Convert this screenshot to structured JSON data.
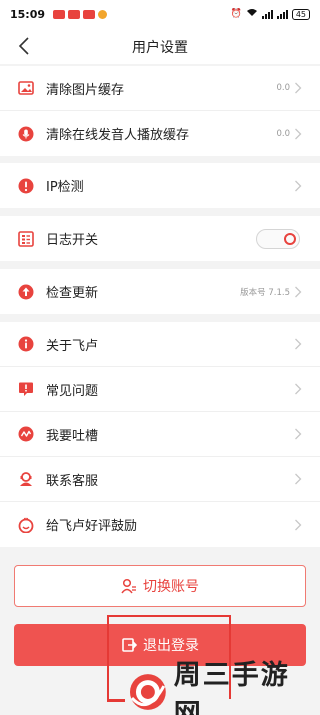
{
  "status_bar": {
    "time": "15:09",
    "battery": "45"
  },
  "nav": {
    "title": "用户设置"
  },
  "cache_group": [
    {
      "label": "清除图片缓存",
      "value": "0.0"
    },
    {
      "label": "清除在线发音人播放缓存",
      "value": "0.0"
    }
  ],
  "ip_group": {
    "label": "IP检测"
  },
  "log_group": {
    "label": "日志开关"
  },
  "update_group": {
    "label": "检查更新",
    "value": "版本号 7.1.5"
  },
  "about_group": [
    {
      "label": "关于飞卢"
    },
    {
      "label": "常见问题"
    },
    {
      "label": "我要吐槽"
    },
    {
      "label": "联系客服"
    },
    {
      "label": "给飞卢好评鼓励"
    }
  ],
  "buttons": {
    "switch_account": "切换账号",
    "logout": "退出登录"
  },
  "watermark": {
    "text": "周三手游网"
  },
  "colors": {
    "accent": "#e8433e",
    "logout_bg": "#ef5350",
    "page_bg": "#f3f3f3"
  }
}
